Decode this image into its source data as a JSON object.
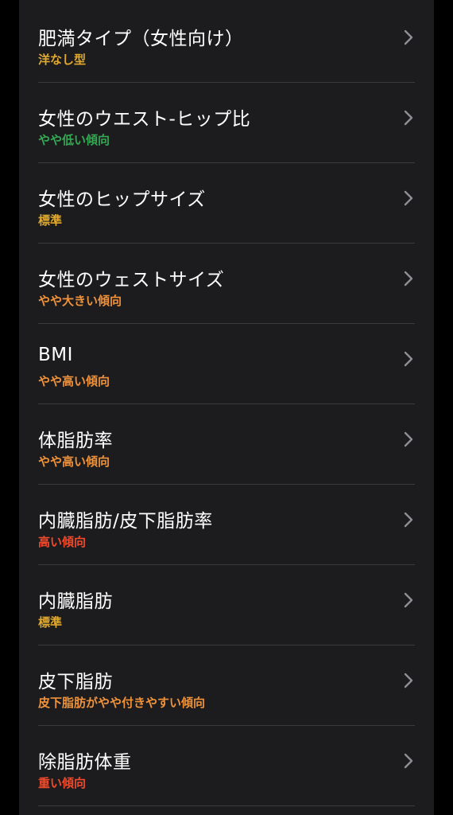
{
  "colors": {
    "background": "#000000",
    "panel": "#1c1c1e",
    "separator": "#3a3a3c",
    "title": "#ffffff",
    "chevron": "#8e8e93",
    "yellow": "#e0a82e",
    "green": "#34a853",
    "orange": "#f0923a",
    "red": "#f24a2b"
  },
  "rows": [
    {
      "title": "肥満タイプ（女性向け）",
      "status": "洋なし型",
      "status_color": "#e0a82e",
      "icon": "chevron-right-icon"
    },
    {
      "title": "女性のウエスト-ヒップ比",
      "status": "やや低い傾向",
      "status_color": "#34a853",
      "icon": "chevron-right-icon"
    },
    {
      "title": "女性のヒップサイズ",
      "status": "標準",
      "status_color": "#e0a82e",
      "icon": "chevron-right-icon"
    },
    {
      "title": "女性のウェストサイズ",
      "status": "やや大きい傾向",
      "status_color": "#f0923a",
      "icon": "chevron-right-icon"
    },
    {
      "title": "BMI",
      "status": "やや高い傾向",
      "status_color": "#f0923a",
      "icon": "chevron-right-icon"
    },
    {
      "title": "体脂肪率",
      "status": "やや高い傾向",
      "status_color": "#f0923a",
      "icon": "chevron-right-icon"
    },
    {
      "title": "内臓脂肪/皮下脂肪率",
      "status": "高い傾向",
      "status_color": "#f24a2b",
      "icon": "chevron-right-icon"
    },
    {
      "title": "内臓脂肪",
      "status": "標準",
      "status_color": "#e0a82e",
      "icon": "chevron-right-icon"
    },
    {
      "title": "皮下脂肪",
      "status": "皮下脂肪がやや付きやすい傾向",
      "status_color": "#f0923a",
      "icon": "chevron-right-icon"
    },
    {
      "title": "除脂肪体重",
      "status": "重い傾向",
      "status_color": "#f24a2b",
      "icon": "chevron-right-icon"
    }
  ]
}
